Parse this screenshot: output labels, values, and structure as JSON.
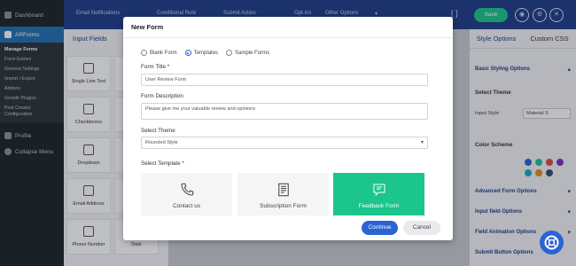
{
  "wp_menu": {
    "dashboard": "Dashboard",
    "arforms": "ARForms",
    "submenu": [
      "Manage Forms",
      "Form Entries",
      "General Settings",
      "Import / Export",
      "Addons",
      "Growth Plugins",
      "Post Creator Configuration"
    ],
    "profile": "Profile",
    "collapse": "Collapse Menu"
  },
  "toolbar": {
    "items": [
      "Email Notifications",
      "Conditional Rule",
      "Submit Action",
      "Opt-ins",
      "Other Options"
    ],
    "save_label": "Save"
  },
  "left_panel": {
    "tab": "Input Fields",
    "fields": [
      "Single Line Text",
      "R",
      "Checkboxes",
      "R",
      "Dropdown",
      "",
      "Email Address",
      "W",
      "Phone Number",
      "Date"
    ]
  },
  "right_panel": {
    "tabs": [
      "Style Options",
      "Custom CSS"
    ],
    "basic_styling": "Basic Styling Options",
    "select_theme": "Select Theme",
    "input_style_label": "Input Style",
    "input_style_value": "Material S",
    "color_scheme": "Color Scheme",
    "swatch_colors": [
      "#2a63d4",
      "#1cc58c",
      "#e4473c",
      "#7b2fd1",
      "#19a9c7",
      "#e58b1a",
      "#3b4a6b"
    ],
    "sections": [
      "Advanced Form Options",
      "Input field Options",
      "Field Animation Options",
      "Submit Button Options"
    ]
  },
  "modal": {
    "title": "New Form",
    "radios": [
      "Blank Form",
      "Templates",
      "Sample Forms"
    ],
    "selected_radio": "Templates",
    "form_title_label": "Form Title *",
    "form_title_placeholder": "User Review Form",
    "description_label": "Form Description",
    "description_value": "Please give me your valuable review and opinions",
    "theme_label": "Select Theme",
    "theme_value": "Rounded Style",
    "template_label": "Select Template *",
    "templates": [
      "Contact us",
      "Subscription Form",
      "Feedback Form"
    ],
    "selected_template": "Feedback Form",
    "continue": "Continue",
    "cancel": "Cancel"
  }
}
